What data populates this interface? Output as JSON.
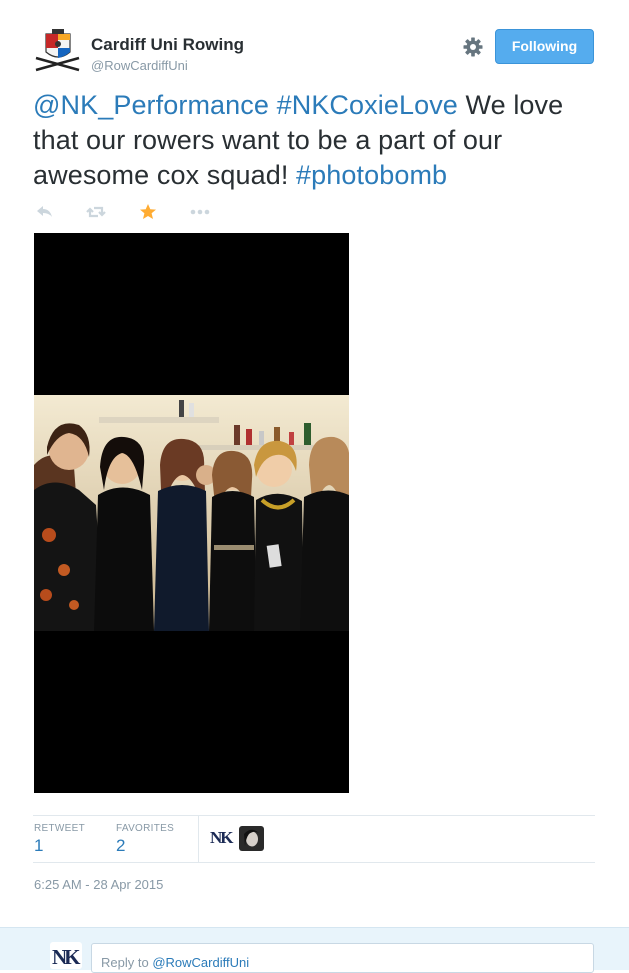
{
  "account": {
    "name": "Cardiff Uni Rowing",
    "handle": "@RowCardiffUni",
    "follow_label": "Following"
  },
  "tweet": {
    "mention": "@NK_Performance",
    "hashtag1": "#NKCoxieLove",
    "body": " We love that our rowers want to be a part of our awesome cox squad! ",
    "hashtag2": "#photobomb"
  },
  "actions": {
    "icons": [
      "reply-icon",
      "retweet-icon",
      "favorite-icon",
      "more-icon"
    ],
    "favorite_color": "#ffac33"
  },
  "stats": {
    "retweet_label": "RETWEET",
    "retweet_count": "1",
    "favorites_label": "FAVORITES",
    "favorites_count": "2",
    "favoriter_logo_text": "NK"
  },
  "timestamp": "6:25 AM - 28 Apr 2015",
  "reply": {
    "placeholder_prefix": "Reply to ",
    "placeholder_mention": "@RowCardiffUni",
    "avatar_text": "NK"
  },
  "colors": {
    "accent": "#55acee",
    "link": "#2b7bb9",
    "muted": "#8899a6"
  }
}
